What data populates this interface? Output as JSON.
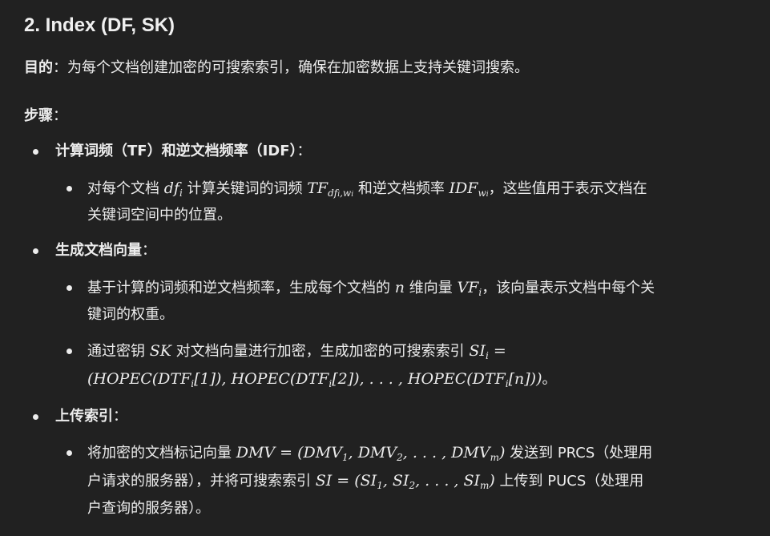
{
  "heading": "2. Index (DF, SK)",
  "purpose": {
    "label": "目的",
    "text": "：为每个文档创建加密的可搜索索引，确保在加密数据上支持关键词搜索。"
  },
  "steps_label": "步骤",
  "steps_colon": "：",
  "steps": [
    {
      "title": "计算词频（TF）和逆文档频率（IDF）",
      "colon": "：",
      "sub": [
        {
          "t1": "对每个文档 ",
          "m1": "df",
          "m1_sub": "i",
          "t2": " 计算关键词的词频 ",
          "m2": "TF",
          "m2_sub": "df",
          "m2_subsub": "i",
          "m2_sub_tail": ",w",
          "m2_subsub2": "i",
          "t3": " 和逆文档频率 ",
          "m3": "IDF",
          "m3_sub": "w",
          "m3_subsub": "i",
          "t4": "，这些值用于表示文档在",
          "line2": "关键词空间中的位置。"
        }
      ]
    },
    {
      "title": "生成文档向量",
      "colon": "：",
      "sub": [
        {
          "t1": "基于计算的词频和逆文档频率，生成每个文档的 ",
          "m1": "n",
          "t2": " 维向量 ",
          "m2": "VF",
          "m2_sub": "i",
          "t3": "，该向量表示文档中每个关",
          "line2": "键词的权重。"
        },
        {
          "t1": "通过密钥 ",
          "m1": "SK",
          "t2": " 对文档向量进行加密，生成加密的可搜索索引 ",
          "m2": "SI",
          "m2_sub": "i",
          "m2_eq": " =",
          "formula": "(HOPEC(DTF",
          "f_sub": "i",
          "f1": "[1]), HOPEC(DTF",
          "f_sub2": "i",
          "f2": "[2]), . . . , HOPEC(DTF",
          "f_sub3": "i",
          "f3": "[n]))",
          "end": "。"
        }
      ]
    },
    {
      "title": "上传索引",
      "colon": "：",
      "sub": [
        {
          "t1": "将加密的文档标记向量 ",
          "m1": "DMV = (DMV",
          "m1_s1": "1",
          "m1_b": ", DMV",
          "m1_s2": "2",
          "m1_c": ", . . . , DMV",
          "m1_s3": "m",
          "m1_d": ")",
          "t2": " 发送到 PRCS（处理用",
          "line2a": "户请求的服务器），并将可搜索索引 ",
          "m2": "SI = (SI",
          "m2_s1": "1",
          "m2_b": ", SI",
          "m2_s2": "2",
          "m2_c": ", . . . , SI",
          "m2_s3": "m",
          "m2_d": ")",
          "t3": " 上传到 PUCS（处理用",
          "line3": "户查询的服务器）。"
        }
      ]
    }
  ]
}
